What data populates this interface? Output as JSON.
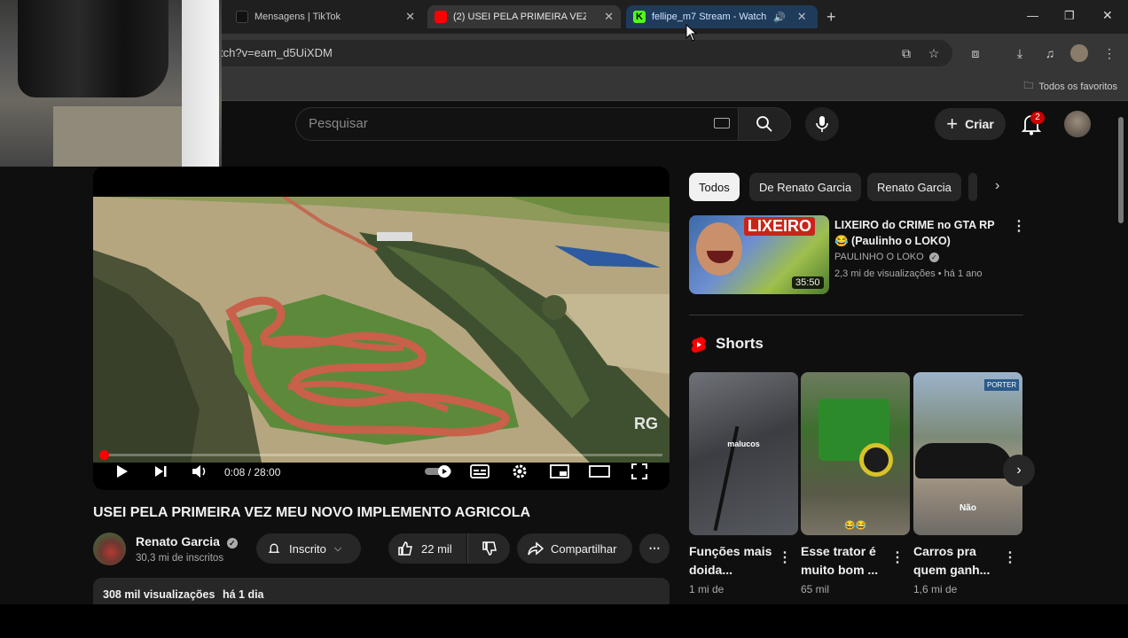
{
  "browser": {
    "tabs": [
      {
        "label": "Mensagens | TikTok",
        "favicon_color": "#111111",
        "state": "normal"
      },
      {
        "label": "(2) USEI PELA PRIMEIRA VEZ ME",
        "favicon_color": "#ff0000",
        "state": "active"
      },
      {
        "label": "fellipe_m7 Stream - Watch",
        "favicon_color": "#53fc18",
        "state": "audio"
      }
    ],
    "new_tab_label": "+",
    "window_controls": {
      "minimize": "—",
      "maximize": "❐",
      "close": "✕"
    },
    "url": "tch?v=eam_d5UiXDM",
    "bookmarks_folder": "Todos os favoritos"
  },
  "youtube": {
    "search_placeholder": "Pesquisar",
    "create_label": "Criar",
    "notifications_count": "2",
    "player": {
      "time": "0:08 / 28:00",
      "progress": 0.005,
      "watermark": "RG"
    },
    "video_title": "USEI PELA PRIMEIRA VEZ MEU NOVO IMPLEMENTO AGRICOLA",
    "channel": {
      "name": "Renato Garcia",
      "subscribers": "30,3 mi de inscritos",
      "subscribe_label": "Inscrito",
      "likes": "22 mil",
      "share_label": "Compartilhar",
      "more_label": "⋯"
    },
    "description": {
      "views": "308 mil visualizações",
      "date": "há 1 dia"
    },
    "chips": [
      "Todos",
      "De Renato Garcia",
      "Renato Garcia"
    ],
    "recommended": {
      "thumb_text": "LIXEIRO",
      "duration": "35:50",
      "title": "LIXEIRO do CRIME no GTA RP 😂 (Paulinho o LOKO)",
      "channel": "PAULINHO O LOKO",
      "meta": "2,3 mi de visualizações • há 1 ano"
    },
    "shorts_heading": "Shorts",
    "shorts": [
      {
        "title": "Funções mais doida...",
        "views": "1 mi de",
        "overlay": "malucos"
      },
      {
        "title": "Esse trator é muito bom ...",
        "views": "65 mil",
        "overlay": "😂😂"
      },
      {
        "title": "Carros pra quem ganh...",
        "views": "1,6 mi de",
        "overlay": "Não",
        "sign": "PORTER"
      }
    ]
  },
  "colors": {
    "accent": "#ff0000",
    "bg": "#0f0f0f",
    "surface": "#272727"
  }
}
